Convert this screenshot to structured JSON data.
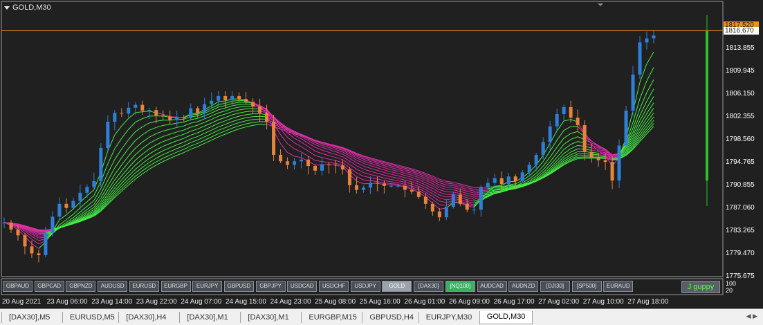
{
  "window": {
    "title": "GOLD,M30"
  },
  "price_axis": {
    "labels": [
      "1813.855",
      "1809.945",
      "1806.150",
      "1802.355",
      "1798.560",
      "1794.765",
      "1790.855",
      "1787.060",
      "1783.265",
      "1779.470",
      "1775.675"
    ],
    "bid": "1817.520",
    "ask": "1816.670",
    "sub_labels": [
      "100",
      "20"
    ]
  },
  "time_axis": {
    "labels": [
      "20 Aug 2021",
      "23 Aug 06:00",
      "23 Aug 14:00",
      "23 Aug 22:00",
      "24 Aug 07:00",
      "24 Aug 15:00",
      "24 Aug 23:00",
      "25 Aug 08:00",
      "25 Aug 16:00",
      "26 Aug 01:00",
      "26 Aug 09:00",
      "26 Aug 17:00",
      "27 Aug 02:00",
      "27 Aug 10:00",
      "27 Aug 18:00"
    ]
  },
  "symbol_buttons": [
    "GBPAUD",
    "GBPCAD",
    "GBPNZD",
    "AUDUSD",
    "EURUSD",
    "EURGBP",
    "EURJPY",
    "GBPUSD",
    "GBPJPY",
    "USDCAD",
    "USDCHF",
    "USDJPY",
    "GOLD",
    "[DAX30]",
    "[NQ100]",
    "AUDCAD",
    "AUDNZD",
    "[DJI30]",
    "[SP500]",
    "EURAUD"
  ],
  "active_symbol": "GOLD",
  "highlight_symbol": "[NQ100]",
  "indicator_button": "J guppy",
  "tabs": [
    "[DAX30],M5",
    "EURUSD,M5",
    "[DAX30],H4",
    "[DAX30],M1",
    "[DAX30],M1",
    "EURGBP,M15",
    "GBPUSD,H4",
    "EURJPY,M30",
    "GOLD,M30"
  ],
  "active_tab": "GOLD,M30",
  "colors": {
    "background": "#202020",
    "bull_candle": "#2f7fd8",
    "bear_candle": "#e8843a",
    "guppy_up": "#44ee44",
    "guppy_down": "#dd2fa8",
    "price_line": "#f0901c",
    "histogram": "#2fc02f"
  },
  "chart_data": {
    "type": "line",
    "ylim": [
      1775.675,
      1817.8
    ],
    "series": [
      {
        "values": [
          1784.6,
          1783.4,
          1782.4,
          1780.5,
          1779.3,
          1779.0,
          1782.8,
          1785.6,
          1787.8,
          1787.1,
          1788.3,
          1789.7,
          1790.7,
          1791.7,
          1797.4,
          1801.9,
          1803.4,
          1803.3,
          1804.3,
          1804.8,
          1803.8,
          1803.9,
          1803.0,
          1802.8,
          1802.2,
          1802.6,
          1802.5,
          1804.2,
          1803.4,
          1804.9,
          1805.5,
          1806.3,
          1805.6,
          1806.3,
          1805.8,
          1805.3,
          1804.5,
          1803.4,
          1801.9,
          1796.2,
          1795.1,
          1794.5,
          1795.1,
          1795.4,
          1794.3,
          1793.5,
          1794.6,
          1794.5,
          1794.4,
          1793.7,
          1791.0,
          1790.2,
          1790.6,
          1791.4,
          1791.3,
          1790.9,
          1790.9,
          1790.9,
          1790.2,
          1789.9,
          1789.0,
          1787.8,
          1786.5,
          1785.5,
          1787.3,
          1789.4,
          1787.8,
          1786.8,
          1786.8,
          1790.7,
          1791.4,
          1792.2,
          1791.2,
          1792.5,
          1791.7,
          1793.2,
          1794.5,
          1796.2,
          1798.4,
          1801.1,
          1803.2,
          1804.4,
          1802.6,
          1801.3,
          1796.7,
          1795.7,
          1795.3,
          1795.0,
          1791.8,
          1797.8,
          1803.8,
          1810.0,
          1815.5,
          1816.2,
          1816.7
        ]
      }
    ]
  }
}
